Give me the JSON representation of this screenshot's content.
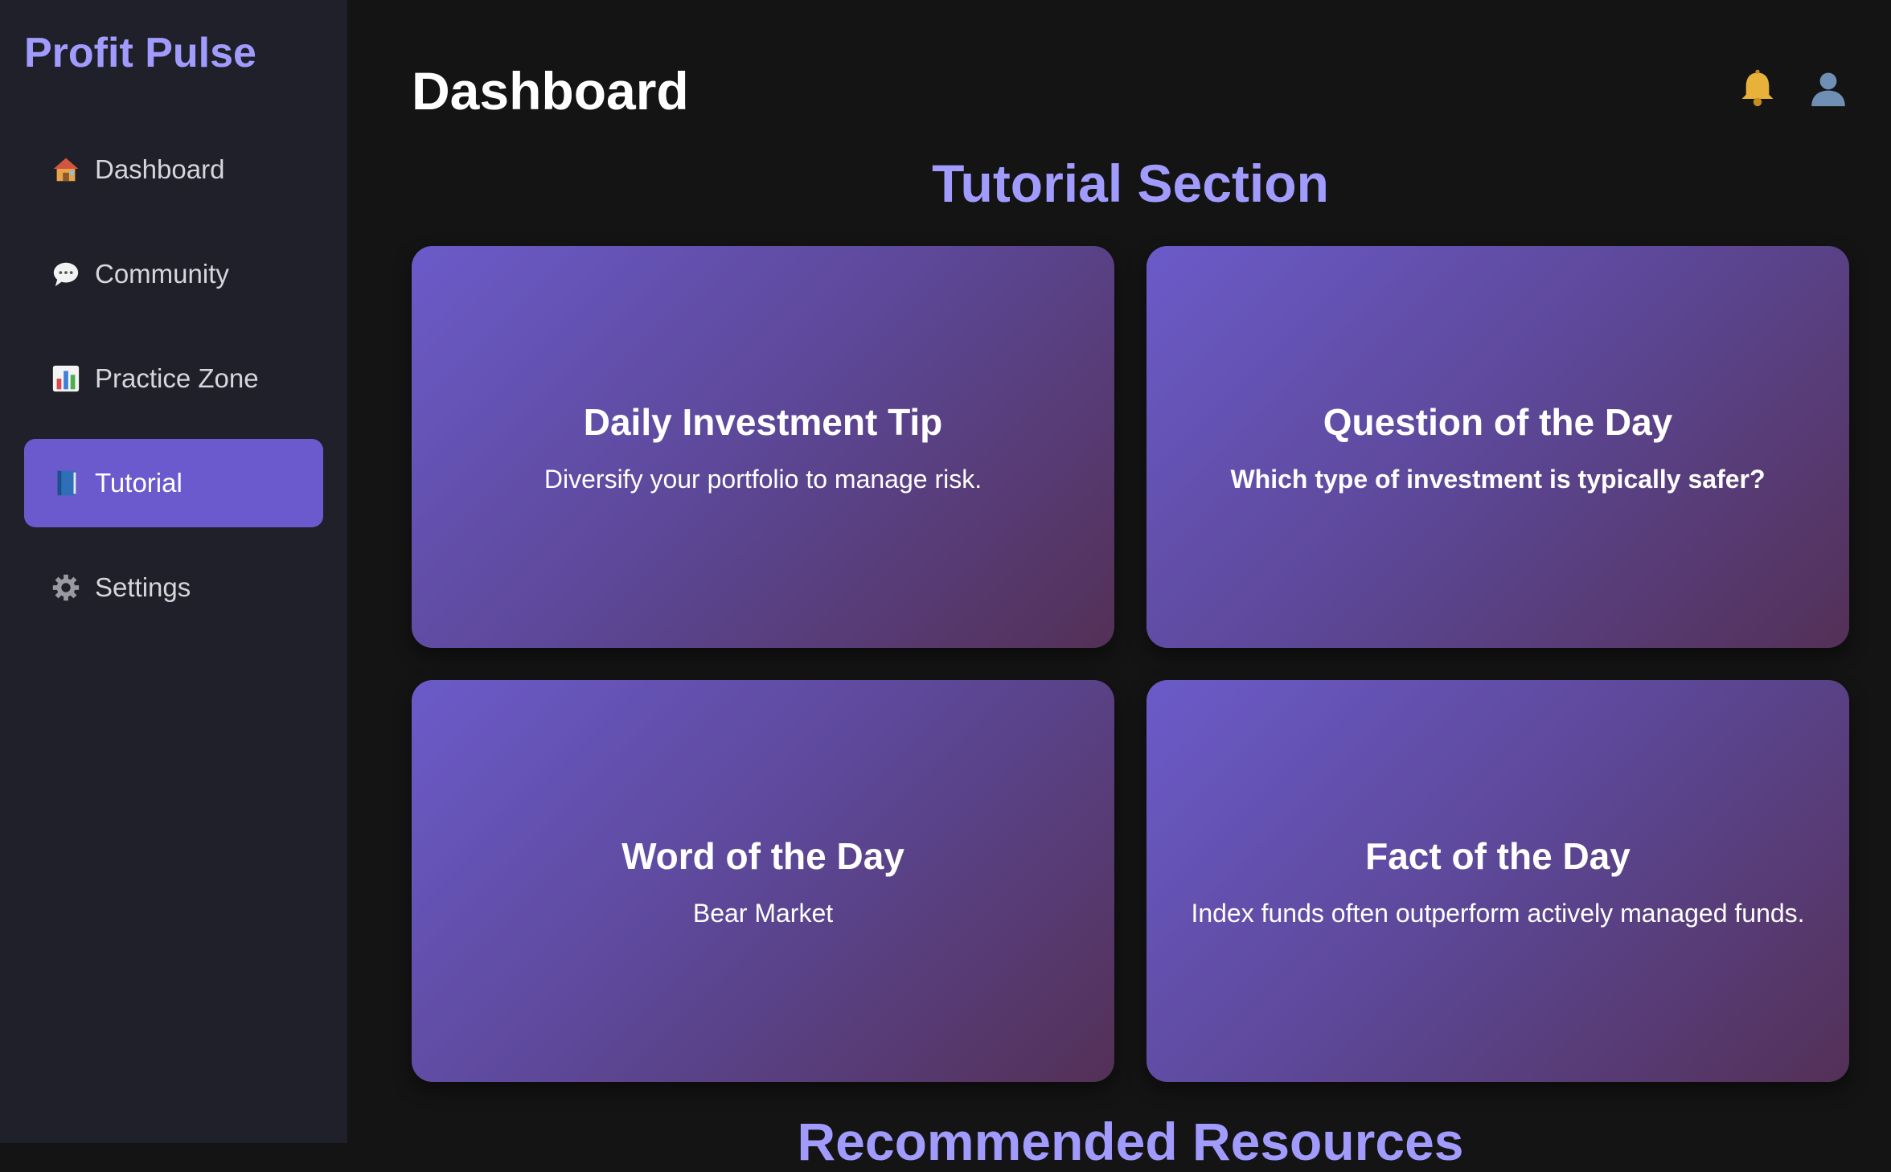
{
  "app": {
    "brand": "Profit Pulse"
  },
  "sidebar": {
    "items": [
      {
        "label": "Dashboard",
        "icon": "house-icon",
        "active": false
      },
      {
        "label": "Community",
        "icon": "speech-bubble-icon",
        "active": false
      },
      {
        "label": "Practice Zone",
        "icon": "bar-chart-icon",
        "active": false
      },
      {
        "label": "Tutorial",
        "icon": "book-icon",
        "active": true
      },
      {
        "label": "Settings",
        "icon": "gear-icon",
        "active": false
      }
    ]
  },
  "header": {
    "title": "Dashboard",
    "icons": [
      "bell-icon",
      "user-icon"
    ]
  },
  "main": {
    "section_title": "Tutorial Section",
    "cards": [
      {
        "title": "Daily Investment Tip",
        "text": "Diversify your portfolio to manage risk."
      },
      {
        "title": "Question of the Day",
        "text": "Which type of investment is typically safer?"
      },
      {
        "title": "Word of the Day",
        "text": "Bear Market"
      },
      {
        "title": "Fact of the Day",
        "text": "Index funds often outperform actively managed funds."
      }
    ],
    "next_section_title": "Recommended Resources"
  },
  "colors": {
    "accent": "#a29bfe",
    "active_nav": "#6a5acd",
    "sidebar_bg": "#1f2029",
    "page_bg": "#141414"
  }
}
